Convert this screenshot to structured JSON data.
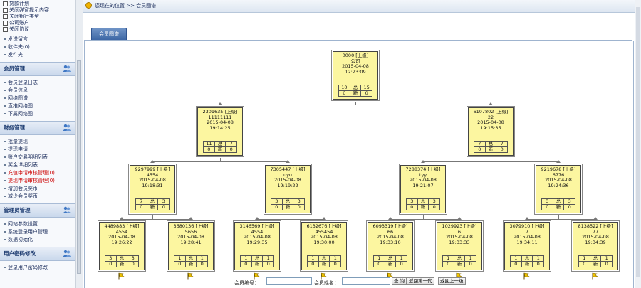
{
  "sidebar": {
    "top_checks": [
      "贷款计划",
      "关闭弹窗提示内容",
      "关闭银行类型",
      "公司账户",
      "关闭协议"
    ],
    "top_links": [
      "发送留言",
      "收件夹(0)",
      "发件夹"
    ],
    "sections": [
      {
        "title": "会员管理",
        "items": [
          {
            "label": "会员登录日志",
            "red": false
          },
          {
            "label": "会员信息",
            "red": false
          },
          {
            "label": "网络图谱",
            "red": false
          },
          {
            "label": "直推网络图",
            "red": false
          },
          {
            "label": "下属网络图",
            "red": false
          }
        ]
      },
      {
        "title": "财务管理",
        "items": [
          {
            "label": "批量提现",
            "red": false
          },
          {
            "label": "提现申请",
            "red": false
          },
          {
            "label": "账户交易明细列表",
            "red": false
          },
          {
            "label": "奖金详细列表",
            "red": false
          },
          {
            "label": "充值申请审核管理(0)",
            "red": true
          },
          {
            "label": "提现申请审核管理(0)",
            "red": true
          },
          {
            "label": "增加会员奖币",
            "red": false
          },
          {
            "label": "减少会员奖币",
            "red": false
          }
        ]
      },
      {
        "title": "管理员管理",
        "items": [
          {
            "label": "网站参数设置",
            "red": false
          },
          {
            "label": "系统登录用户管理",
            "red": false
          },
          {
            "label": "数据初始化",
            "red": false
          }
        ]
      },
      {
        "title": "用户密码修改",
        "items": [
          {
            "label": "登录用户密码修改",
            "red": false
          }
        ]
      }
    ]
  },
  "breadcrumb": "您现在的位置 >> 会员图谱",
  "tab": {
    "label": "会员图谱"
  },
  "tree": {
    "nodes": [
      {
        "id": "0000 [上级]",
        "name": "公司",
        "date": "2015-04-08",
        "time": "12:23:09",
        "row1": [
          "10",
          "总",
          "15"
        ],
        "row2": [
          "0",
          "新",
          "0"
        ]
      },
      {
        "id": "2301635 [上级]",
        "name": "11111111",
        "date": "2015-04-08",
        "time": "19:14:25",
        "row1": [
          "11",
          "总",
          "7"
        ],
        "row2": [
          "0",
          "新",
          "0"
        ]
      },
      {
        "id": "6107802 [上级]",
        "name": "22",
        "date": "2015-04-08",
        "time": "19:15:35",
        "row1": [
          "7",
          "总",
          "7"
        ],
        "row2": [
          "0",
          "新",
          "0"
        ]
      },
      {
        "id": "9297999 [上级]",
        "name": "4554",
        "date": "2015-04-08",
        "time": "19:18:31",
        "row1": [
          "7",
          "总",
          "3"
        ],
        "row2": [
          "0",
          "新",
          "0"
        ]
      },
      {
        "id": "7305447 [上级]",
        "name": "uyu",
        "date": "2015-04-08",
        "time": "19:19:22",
        "row1": [
          "3",
          "总",
          "3"
        ],
        "row2": [
          "0",
          "新",
          "0"
        ]
      },
      {
        "id": "7288374 [上级]",
        "name": "tyy",
        "date": "2015-04-08",
        "time": "19:21:07",
        "row1": [
          "3",
          "总",
          "3"
        ],
        "row2": [
          "0",
          "新",
          "0"
        ]
      },
      {
        "id": "9219678 [上级]",
        "name": "6776",
        "date": "2015-04-08",
        "time": "19:24:36",
        "row1": [
          "3",
          "总",
          "3"
        ],
        "row2": [
          "0",
          "新",
          "0"
        ]
      },
      {
        "id": "4489883 [上级]",
        "name": "4554",
        "date": "2015-04-08",
        "time": "19:26:22",
        "row1": [
          "3",
          "总",
          "3"
        ],
        "row2": [
          "0",
          "新",
          "0"
        ]
      },
      {
        "id": "3680136 [上级]",
        "name": "5656",
        "date": "2015-04-08",
        "time": "19:28:41",
        "row1": [
          "1",
          "总",
          "1"
        ],
        "row2": [
          "0",
          "新",
          "0"
        ]
      },
      {
        "id": "3146569 [上级]",
        "name": "4554",
        "date": "2015-04-08",
        "time": "19:29:35",
        "row1": [
          "1",
          "总",
          "1"
        ],
        "row2": [
          "0",
          "新",
          "0"
        ]
      },
      {
        "id": "6132676 [上级]",
        "name": "455454",
        "date": "2015-04-08",
        "time": "19:30:00",
        "row1": [
          "1",
          "总",
          "1"
        ],
        "row2": [
          "0",
          "新",
          "0"
        ]
      },
      {
        "id": "6093319 [上级]",
        "name": "66",
        "date": "2015-04-08",
        "time": "19:33:10",
        "row1": [
          "1",
          "总",
          "1"
        ],
        "row2": [
          "0",
          "新",
          "0"
        ]
      },
      {
        "id": "1029923 [上级]",
        "name": "6",
        "date": "2015-04-08",
        "time": "19:33:33",
        "row1": [
          "1",
          "总",
          "1"
        ],
        "row2": [
          "0",
          "新",
          "0"
        ]
      },
      {
        "id": "3079910 [上级]",
        "name": "7",
        "date": "2015-04-08",
        "time": "19:34:11",
        "row1": [
          "1",
          "总",
          "1"
        ],
        "row2": [
          "0",
          "新",
          "0"
        ]
      },
      {
        "id": "8138522 [上级]",
        "name": "77",
        "date": "2015-04-08",
        "time": "19:34:39",
        "row1": [
          "1",
          "总",
          "1"
        ],
        "row2": [
          "0",
          "新",
          "0"
        ]
      }
    ]
  },
  "search": {
    "member_no_label": "会员编号：",
    "member_name_label": "会员姓名：",
    "query_button": "查 询",
    "back_first_button": "返回第一代",
    "back_prev_button": "返回上一级"
  },
  "colors": {
    "node_fill": "#fcf6a0",
    "accent": "#3d67a5"
  },
  "icons": {
    "leaf_marker": "yellow-flag-icon"
  }
}
